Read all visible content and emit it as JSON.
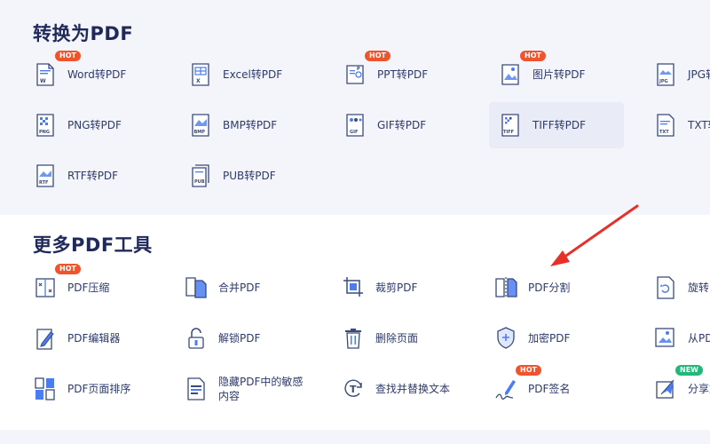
{
  "sections": [
    {
      "title": "转换为PDF",
      "tools": [
        {
          "label": "Word转PDF",
          "badge": "HOT",
          "icon": "word-file-icon"
        },
        {
          "label": "Excel转PDF",
          "badge": "",
          "icon": "excel-file-icon"
        },
        {
          "label": "PPT转PDF",
          "badge": "HOT",
          "icon": "ppt-file-icon"
        },
        {
          "label": "图片转PDF",
          "badge": "HOT",
          "icon": "image-file-icon"
        },
        {
          "label": "JPG转PDF",
          "badge": "",
          "icon": "jpg-file-icon"
        },
        {
          "label": "PNG转PDF",
          "badge": "",
          "icon": "png-file-icon"
        },
        {
          "label": "BMP转PDF",
          "badge": "",
          "icon": "bmp-file-icon"
        },
        {
          "label": "GIF转PDF",
          "badge": "",
          "icon": "gif-file-icon"
        },
        {
          "label": "TIFF转PDF",
          "badge": "",
          "icon": "tiff-file-icon"
        },
        {
          "label": "TXT转PDF",
          "badge": "",
          "icon": "txt-file-icon"
        },
        {
          "label": "RTF转PDF",
          "badge": "",
          "icon": "rtf-file-icon"
        },
        {
          "label": "PUB转PDF",
          "badge": "",
          "icon": "pub-file-icon"
        }
      ]
    },
    {
      "title": "更多PDF工具",
      "tools": [
        {
          "label": "PDF压缩",
          "badge": "HOT",
          "icon": "compress-icon"
        },
        {
          "label": "合并PDF",
          "badge": "",
          "icon": "merge-icon"
        },
        {
          "label": "裁剪PDF",
          "badge": "",
          "icon": "crop-icon"
        },
        {
          "label": "PDF分割",
          "badge": "",
          "icon": "split-icon"
        },
        {
          "label": "旋转PDF",
          "badge": "",
          "icon": "rotate-icon"
        },
        {
          "label": "PDF编辑器",
          "badge": "",
          "icon": "edit-pen-icon"
        },
        {
          "label": "解锁PDF",
          "badge": "",
          "icon": "unlock-icon"
        },
        {
          "label": "删除页面",
          "badge": "",
          "icon": "trash-icon"
        },
        {
          "label": "加密PDF",
          "badge": "",
          "icon": "shield-icon"
        },
        {
          "label": "从PDF提取图片",
          "badge": "",
          "icon": "extract-image-icon"
        },
        {
          "label": "PDF页面排序",
          "badge": "",
          "icon": "reorder-pages-icon"
        },
        {
          "label": "隐藏PDF中的敏感内容",
          "badge": "",
          "icon": "redact-icon"
        },
        {
          "label": "查找并替换文本",
          "badge": "",
          "icon": "find-replace-icon"
        },
        {
          "label": "PDF签名",
          "badge": "HOT",
          "icon": "signature-icon"
        },
        {
          "label": "分享文件",
          "badge": "NEW",
          "icon": "share-icon"
        }
      ]
    }
  ],
  "colors": {
    "accent": "#4a7cf2",
    "icon_stroke": "#3a4a7a",
    "hot_badge": "#f0542d",
    "new_badge": "#21b87a",
    "arrow": "#e8302a"
  }
}
